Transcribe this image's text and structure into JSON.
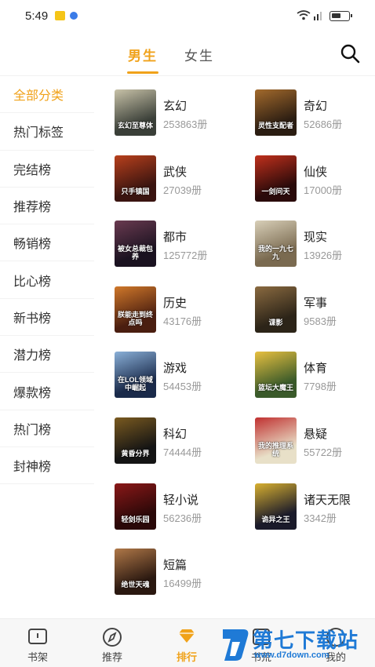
{
  "status_bar": {
    "time": "5:49"
  },
  "header": {
    "tabs": [
      {
        "label": "男生",
        "active": true
      },
      {
        "label": "女生",
        "active": false
      }
    ],
    "accent_color": "#f0a21a"
  },
  "sidebar": {
    "items": [
      {
        "label": "全部分类",
        "active": true
      },
      {
        "label": "热门标签"
      },
      {
        "label": "完结榜"
      },
      {
        "label": "推荐榜"
      },
      {
        "label": "畅销榜"
      },
      {
        "label": "比心榜"
      },
      {
        "label": "新书榜"
      },
      {
        "label": "潜力榜"
      },
      {
        "label": "爆款榜"
      },
      {
        "label": "热门榜"
      },
      {
        "label": "封神榜"
      }
    ]
  },
  "categories": [
    {
      "name": "玄幻",
      "count": "253863册",
      "cover_text": "玄幻至尊体",
      "cover_color": "#3a3f38",
      "cover_color2": "#c8c2a8"
    },
    {
      "name": "奇幻",
      "count": "52686册",
      "cover_text": "灵性支配者",
      "cover_color": "#2b1d12",
      "cover_color2": "#a36a2c"
    },
    {
      "name": "武侠",
      "count": "27039册",
      "cover_text": "只手镇国",
      "cover_color": "#3a1410",
      "cover_color2": "#b8401c"
    },
    {
      "name": "仙侠",
      "count": "17000册",
      "cover_text": "一剑问天",
      "cover_color": "#2a0a0a",
      "cover_color2": "#c0301c"
    },
    {
      "name": "都市",
      "count": "125772册",
      "cover_text": "被女总裁包养",
      "cover_color": "#1a1220",
      "cover_color2": "#6a3a50"
    },
    {
      "name": "现实",
      "count": "13926册",
      "cover_text": "我的一九七九",
      "cover_color": "#7a6a50",
      "cover_color2": "#d8cfb8"
    },
    {
      "name": "历史",
      "count": "43176册",
      "cover_text": "朕能走到终点吗",
      "cover_color": "#4a1e10",
      "cover_color2": "#d0782a"
    },
    {
      "name": "军事",
      "count": "9583册",
      "cover_text": "谍影",
      "cover_color": "#2c2418",
      "cover_color2": "#8a6a40"
    },
    {
      "name": "游戏",
      "count": "54453册",
      "cover_text": "在LOL领域中崛起",
      "cover_color": "#1a2a4a",
      "cover_color2": "#8ab0d8"
    },
    {
      "name": "体育",
      "count": "7798册",
      "cover_text": "篮坛大魔王",
      "cover_color": "#3a5a2a",
      "cover_color2": "#e8c040"
    },
    {
      "name": "科幻",
      "count": "74444册",
      "cover_text": "黄昏分界",
      "cover_color": "#141414",
      "cover_color2": "#7a5a20"
    },
    {
      "name": "悬疑",
      "count": "55722册",
      "cover_text": "我的推理系统",
      "cover_color": "#e8e0c8",
      "cover_color2": "#c03030"
    },
    {
      "name": "轻小说",
      "count": "56236册",
      "cover_text": "轻剑乐园",
      "cover_color": "#2a0808",
      "cover_color2": "#8a1818"
    },
    {
      "name": "诸天无限",
      "count": "3342册",
      "cover_text": "诡异之王",
      "cover_color": "#1a1a2a",
      "cover_color2": "#d8b030"
    },
    {
      "name": "短篇",
      "count": "16499册",
      "cover_text": "绝世天魂",
      "cover_color": "#2a1810",
      "cover_color2": "#b07848"
    }
  ],
  "bottom_nav": {
    "items": [
      {
        "label": "书架",
        "icon": "bookshelf-icon"
      },
      {
        "label": "推荐",
        "icon": "compass-icon"
      },
      {
        "label": "排行",
        "icon": "ranking-icon",
        "active": true
      },
      {
        "label": "书荒",
        "icon": "book-icon"
      },
      {
        "label": "我的",
        "icon": "profile-icon"
      }
    ]
  },
  "watermark": {
    "title": "第七下载站",
    "url": "www.d7down.com"
  }
}
